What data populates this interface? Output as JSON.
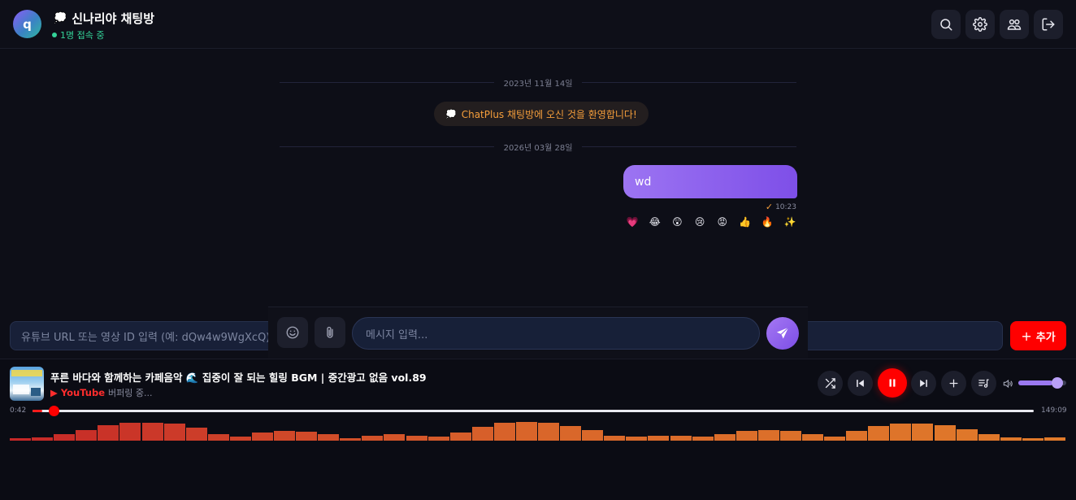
{
  "header": {
    "avatar_letter": "q",
    "room_icon": "💭",
    "room_name": "신나리야 채팅방",
    "online_status": "1명 접속 중",
    "buttons": [
      "search-icon",
      "gear-icon",
      "users-icon",
      "logout-icon"
    ]
  },
  "chat": {
    "date_separator_1": "2023년 11월 14일",
    "welcome_icon": "💭",
    "welcome_text": "ChatPlus 채팅방에 오신 것을 환영합니다!",
    "date_separator_2": "2026년 03월 28일",
    "message": {
      "text": "wd",
      "check": "✓",
      "time": "10:23"
    },
    "reactions": [
      "💗",
      "😂",
      "😲",
      "😢",
      "😡",
      "👍",
      "🔥",
      "✨"
    ]
  },
  "youtube_bar": {
    "url_placeholder": "유튜브 URL 또는 영상 ID 입력 (예: dQw4w9WgXcQ)",
    "add_plus": "+",
    "add_label": "추가"
  },
  "composer": {
    "message_placeholder": "메시지 입력..."
  },
  "player": {
    "title": "푸른 바다와 함께하는 카페음악 🌊 집중이 잘 되는 힐링 BGM | 중간광고 없음 vol.89",
    "source_prefix": "▶ YouTube",
    "source_status": "버퍼링 중...",
    "time_current": "0:42",
    "time_total": "149:09",
    "progress": 0.01,
    "volume": 0.72,
    "visualizer_levels": [
      0.12,
      0.14,
      0.3,
      0.5,
      0.72,
      0.85,
      0.85,
      0.8,
      0.6,
      0.32,
      0.2,
      0.4,
      0.45,
      0.42,
      0.3,
      0.1,
      0.25,
      0.3,
      0.25,
      0.2,
      0.4,
      0.66,
      0.85,
      0.9,
      0.85,
      0.7,
      0.5,
      0.25,
      0.2,
      0.25,
      0.25,
      0.2,
      0.3,
      0.45,
      0.5,
      0.48,
      0.3,
      0.2,
      0.45,
      0.7,
      0.82,
      0.82,
      0.72,
      0.55,
      0.32,
      0.15,
      0.12,
      0.15
    ],
    "visualizer_colors": [
      "#c62828",
      "#d9662a",
      "#e07a2a"
    ]
  }
}
